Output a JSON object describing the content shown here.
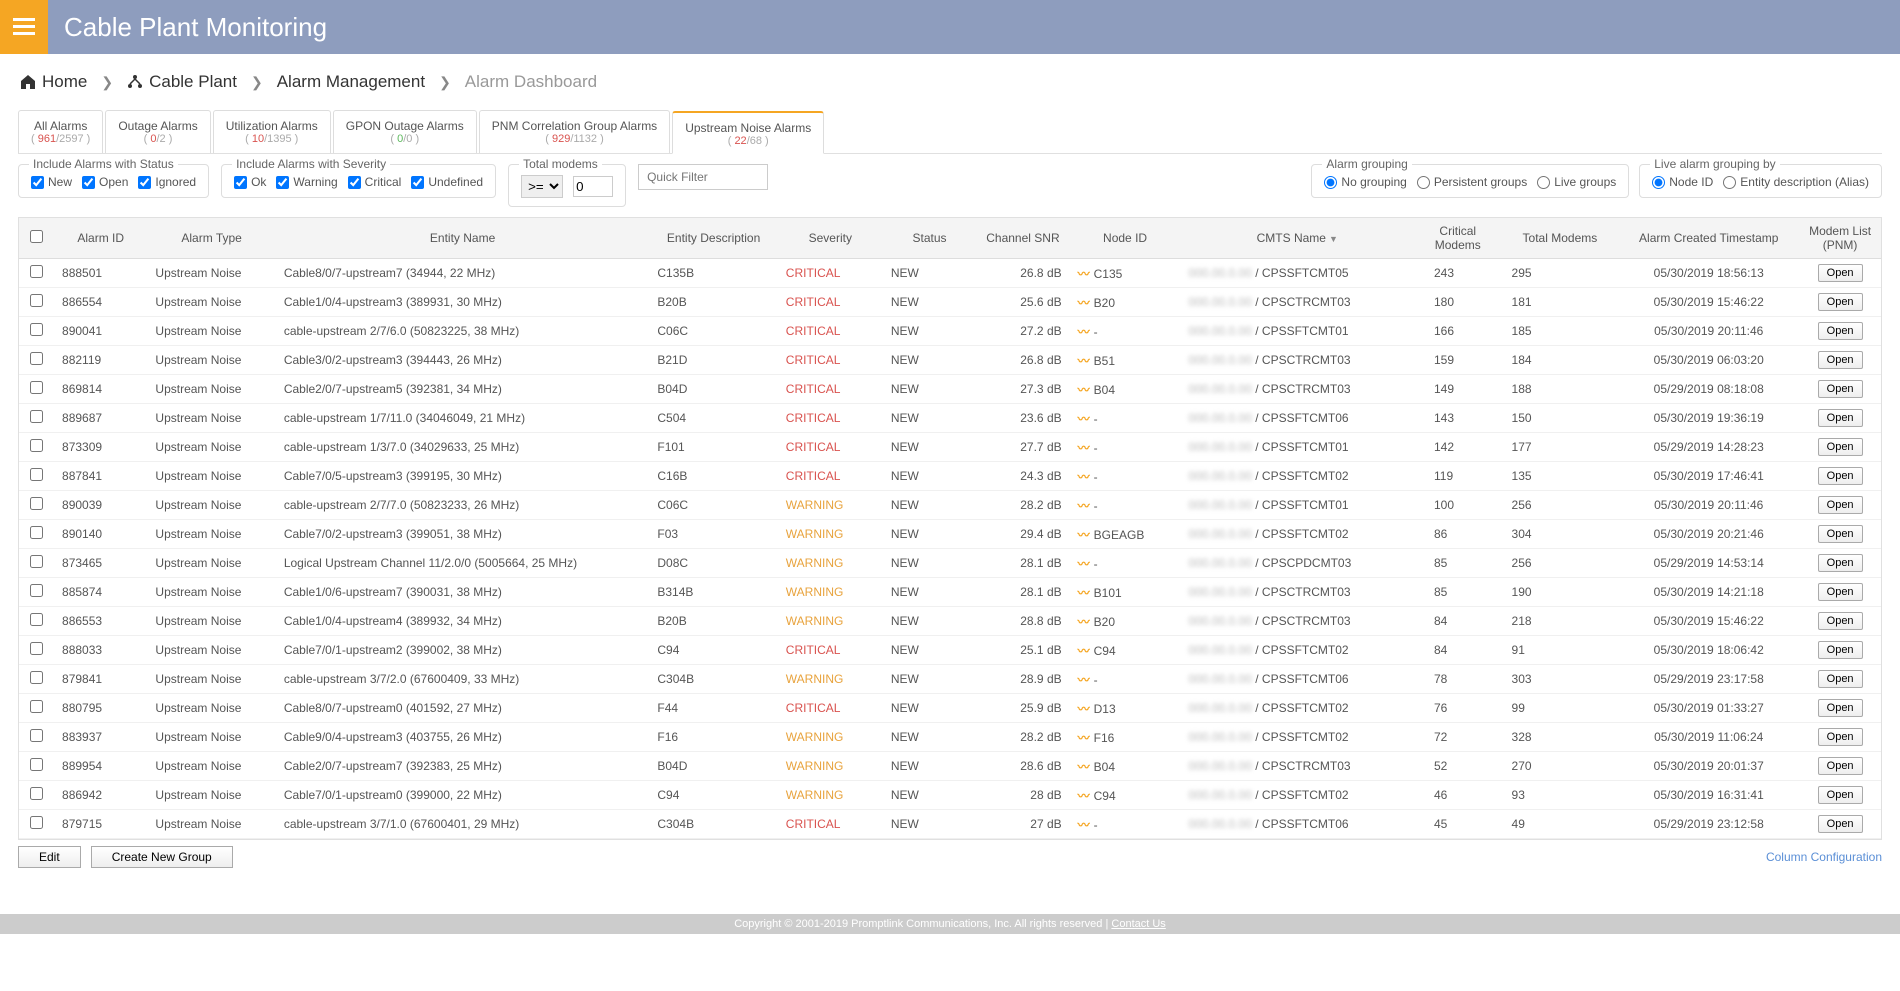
{
  "header": {
    "title": "Cable Plant Monitoring"
  },
  "breadcrumb": {
    "home": "Home",
    "cable_plant": "Cable Plant",
    "alarm_mgmt": "Alarm Management",
    "dashboard": "Alarm Dashboard"
  },
  "tabs": [
    {
      "label": "All Alarms",
      "count_red": "961",
      "count_total": "/2597"
    },
    {
      "label": "Outage Alarms",
      "count_red": "0",
      "count_total": "/2"
    },
    {
      "label": "Utilization Alarms",
      "count_red": "10",
      "count_total": "/1395"
    },
    {
      "label": "GPON Outage Alarms",
      "count_green": "0",
      "count_total": "/0"
    },
    {
      "label": "PNM Correlation Group Alarms",
      "count_red": "929",
      "count_total": "/1132"
    },
    {
      "label": "Upstream Noise Alarms",
      "count_red": "22",
      "count_total": "/68",
      "active": true
    }
  ],
  "filters": {
    "status_legend": "Include Alarms with Status",
    "status_new": "New",
    "status_open": "Open",
    "status_ignored": "Ignored",
    "severity_legend": "Include Alarms with Severity",
    "sev_ok": "Ok",
    "sev_warning": "Warning",
    "sev_critical": "Critical",
    "sev_undefined": "Undefined",
    "total_modems_legend": "Total modems",
    "total_op": ">=",
    "total_val": "0",
    "quick_placeholder": "Quick Filter",
    "grouping_legend": "Alarm grouping",
    "grp_none": "No grouping",
    "grp_persist": "Persistent groups",
    "grp_live": "Live groups",
    "live_legend": "Live alarm grouping by",
    "live_node": "Node ID",
    "live_entity": "Entity description (Alias)"
  },
  "columns": {
    "check": "",
    "id": "Alarm ID",
    "type": "Alarm Type",
    "entity": "Entity Name",
    "desc": "Entity Description",
    "sev": "Severity",
    "status": "Status",
    "snr": "Channel SNR",
    "node": "Node ID",
    "cmts": "CMTS Name",
    "crit": "Critical Modems",
    "tot": "Total Modems",
    "ts": "Alarm Created Timestamp",
    "open": "Modem List (PNM)"
  },
  "rows": [
    {
      "id": "888501",
      "type": "Upstream Noise",
      "entity": "Cable8/0/7-upstream7 (34944, 22 MHz)",
      "desc": "C135B",
      "sev": "CRITICAL",
      "status": "NEW",
      "snr": "26.8 dB",
      "node": "C135",
      "cmts": "CPSSFTCMT05",
      "crit": "243",
      "tot": "295",
      "ts": "05/30/2019 18:56:13"
    },
    {
      "id": "886554",
      "type": "Upstream Noise",
      "entity": "Cable1/0/4-upstream3 (389931, 30 MHz)",
      "desc": "B20B",
      "sev": "CRITICAL",
      "status": "NEW",
      "snr": "25.6 dB",
      "node": "B20",
      "cmts": "CPSCTRCMT03",
      "crit": "180",
      "tot": "181",
      "ts": "05/30/2019 15:46:22"
    },
    {
      "id": "890041",
      "type": "Upstream Noise",
      "entity": "cable-upstream 2/7/6.0 (50823225, 38 MHz)",
      "desc": "C06C",
      "sev": "CRITICAL",
      "status": "NEW",
      "snr": "27.2 dB",
      "node": "-",
      "cmts": "CPSSFTCMT01",
      "crit": "166",
      "tot": "185",
      "ts": "05/30/2019 20:11:46"
    },
    {
      "id": "882119",
      "type": "Upstream Noise",
      "entity": "Cable3/0/2-upstream3 (394443, 26 MHz)",
      "desc": "B21D",
      "sev": "CRITICAL",
      "status": "NEW",
      "snr": "26.8 dB",
      "node": "B51",
      "cmts": "CPSCTRCMT03",
      "crit": "159",
      "tot": "184",
      "ts": "05/30/2019 06:03:20"
    },
    {
      "id": "869814",
      "type": "Upstream Noise",
      "entity": "Cable2/0/7-upstream5 (392381, 34 MHz)",
      "desc": "B04D",
      "sev": "CRITICAL",
      "status": "NEW",
      "snr": "27.3 dB",
      "node": "B04",
      "cmts": "CPSCTRCMT03",
      "crit": "149",
      "tot": "188",
      "ts": "05/29/2019 08:18:08"
    },
    {
      "id": "889687",
      "type": "Upstream Noise",
      "entity": "cable-upstream 1/7/11.0 (34046049, 21 MHz)",
      "desc": "C504",
      "sev": "CRITICAL",
      "status": "NEW",
      "snr": "23.6 dB",
      "node": "-",
      "cmts": "CPSSFTCMT06",
      "crit": "143",
      "tot": "150",
      "ts": "05/30/2019 19:36:19"
    },
    {
      "id": "873309",
      "type": "Upstream Noise",
      "entity": "cable-upstream 1/3/7.0 (34029633, 25 MHz)",
      "desc": "F101",
      "sev": "CRITICAL",
      "status": "NEW",
      "snr": "27.7 dB",
      "node": "-",
      "cmts": "CPSSFTCMT01",
      "crit": "142",
      "tot": "177",
      "ts": "05/29/2019 14:28:23"
    },
    {
      "id": "887841",
      "type": "Upstream Noise",
      "entity": "Cable7/0/5-upstream3 (399195, 30 MHz)",
      "desc": "C16B",
      "sev": "CRITICAL",
      "status": "NEW",
      "snr": "24.3 dB",
      "node": "-",
      "cmts": "CPSSFTCMT02",
      "crit": "119",
      "tot": "135",
      "ts": "05/30/2019 17:46:41"
    },
    {
      "id": "890039",
      "type": "Upstream Noise",
      "entity": "cable-upstream 2/7/7.0 (50823233, 26 MHz)",
      "desc": "C06C",
      "sev": "WARNING",
      "status": "NEW",
      "snr": "28.2 dB",
      "node": "-",
      "cmts": "CPSSFTCMT01",
      "crit": "100",
      "tot": "256",
      "ts": "05/30/2019 20:11:46"
    },
    {
      "id": "890140",
      "type": "Upstream Noise",
      "entity": "Cable7/0/2-upstream3 (399051, 38 MHz)",
      "desc": "F03",
      "sev": "WARNING",
      "status": "NEW",
      "snr": "29.4 dB",
      "node": "BGEAGB",
      "cmts": "CPSSFTCMT02",
      "crit": "86",
      "tot": "304",
      "ts": "05/30/2019 20:21:46"
    },
    {
      "id": "873465",
      "type": "Upstream Noise",
      "entity": "Logical Upstream Channel 11/2.0/0 (5005664, 25 MHz)",
      "desc": "D08C",
      "sev": "WARNING",
      "status": "NEW",
      "snr": "28.1 dB",
      "node": "-",
      "cmts": "CPSCPDCMT03",
      "crit": "85",
      "tot": "256",
      "ts": "05/29/2019 14:53:14"
    },
    {
      "id": "885874",
      "type": "Upstream Noise",
      "entity": "Cable1/0/6-upstream7 (390031, 38 MHz)",
      "desc": "B314B",
      "sev": "WARNING",
      "status": "NEW",
      "snr": "28.1 dB",
      "node": "B101",
      "cmts": "CPSCTRCMT03",
      "crit": "85",
      "tot": "190",
      "ts": "05/30/2019 14:21:18"
    },
    {
      "id": "886553",
      "type": "Upstream Noise",
      "entity": "Cable1/0/4-upstream4 (389932, 34 MHz)",
      "desc": "B20B",
      "sev": "WARNING",
      "status": "NEW",
      "snr": "28.8 dB",
      "node": "B20",
      "cmts": "CPSCTRCMT03",
      "crit": "84",
      "tot": "218",
      "ts": "05/30/2019 15:46:22"
    },
    {
      "id": "888033",
      "type": "Upstream Noise",
      "entity": "Cable7/0/1-upstream2 (399002, 38 MHz)",
      "desc": "C94",
      "sev": "CRITICAL",
      "status": "NEW",
      "snr": "25.1 dB",
      "node": "C94",
      "cmts": "CPSSFTCMT02",
      "crit": "84",
      "tot": "91",
      "ts": "05/30/2019 18:06:42"
    },
    {
      "id": "879841",
      "type": "Upstream Noise",
      "entity": "cable-upstream 3/7/2.0 (67600409, 33 MHz)",
      "desc": "C304B",
      "sev": "WARNING",
      "status": "NEW",
      "snr": "28.9 dB",
      "node": "-",
      "cmts": "CPSSFTCMT06",
      "crit": "78",
      "tot": "303",
      "ts": "05/29/2019 23:17:58"
    },
    {
      "id": "880795",
      "type": "Upstream Noise",
      "entity": "Cable8/0/7-upstream0 (401592, 27 MHz)",
      "desc": "F44",
      "sev": "CRITICAL",
      "status": "NEW",
      "snr": "25.9 dB",
      "node": "D13",
      "cmts": "CPSSFTCMT02",
      "crit": "76",
      "tot": "99",
      "ts": "05/30/2019 01:33:27"
    },
    {
      "id": "883937",
      "type": "Upstream Noise",
      "entity": "Cable9/0/4-upstream3 (403755, 26 MHz)",
      "desc": "F16",
      "sev": "WARNING",
      "status": "NEW",
      "snr": "28.2 dB",
      "node": "F16",
      "cmts": "CPSSFTCMT02",
      "crit": "72",
      "tot": "328",
      "ts": "05/30/2019 11:06:24"
    },
    {
      "id": "889954",
      "type": "Upstream Noise",
      "entity": "Cable2/0/7-upstream7 (392383, 25 MHz)",
      "desc": "B04D",
      "sev": "WARNING",
      "status": "NEW",
      "snr": "28.6 dB",
      "node": "B04",
      "cmts": "CPSCTRCMT03",
      "crit": "52",
      "tot": "270",
      "ts": "05/30/2019 20:01:37"
    },
    {
      "id": "886942",
      "type": "Upstream Noise",
      "entity": "Cable7/0/1-upstream0 (399000, 22 MHz)",
      "desc": "C94",
      "sev": "WARNING",
      "status": "NEW",
      "snr": "28 dB",
      "node": "C94",
      "cmts": "CPSSFTCMT02",
      "crit": "46",
      "tot": "93",
      "ts": "05/30/2019 16:31:41"
    },
    {
      "id": "879715",
      "type": "Upstream Noise",
      "entity": "cable-upstream 3/7/1.0 (67600401, 29 MHz)",
      "desc": "C304B",
      "sev": "CRITICAL",
      "status": "NEW",
      "snr": "27 dB",
      "node": "-",
      "cmts": "CPSSFTCMT06",
      "crit": "45",
      "tot": "49",
      "ts": "05/29/2019 23:12:58"
    }
  ],
  "buttons": {
    "edit": "Edit",
    "create_group": "Create New Group",
    "open": "Open",
    "col_config": "Column Configuration"
  },
  "footer": {
    "copyright": "Copyright © 2001-2019 Promptlink Communications, Inc. All rights reserved",
    "contact": "Contact Us"
  }
}
